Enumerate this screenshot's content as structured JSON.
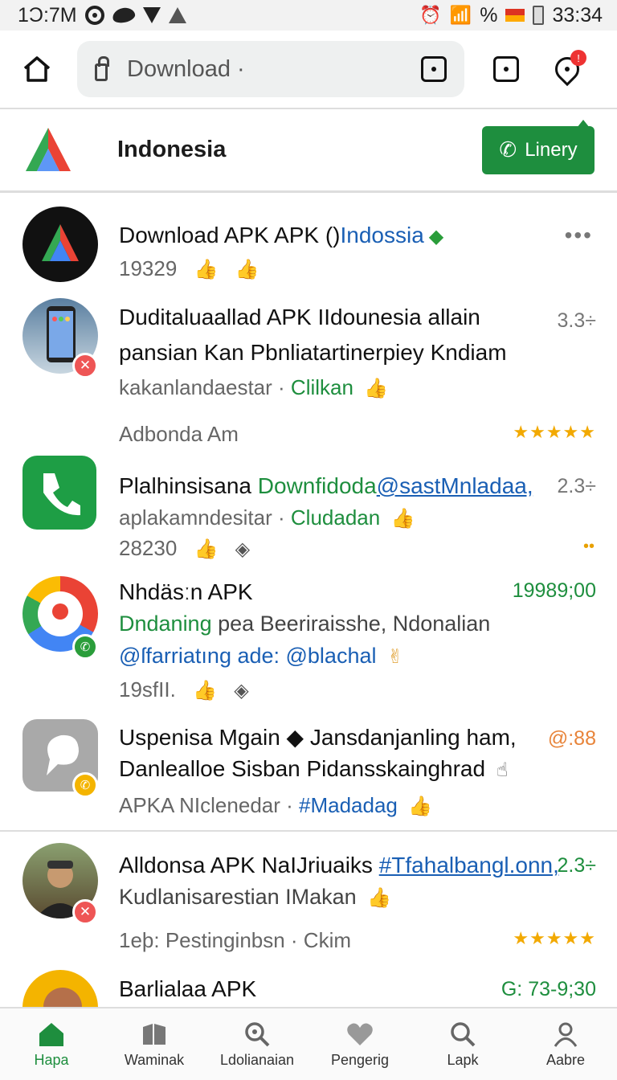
{
  "status_bar": {
    "time_left": "1Ɔ:7M",
    "battery_text": "%",
    "time_right": "33:34"
  },
  "toolbar": {
    "url_text": "Download ·"
  },
  "header": {
    "title": "Indonesia",
    "call_button_label": "Linery"
  },
  "items": [
    {
      "title": "Download APK APK ()",
      "title_link": "Indossia",
      "stat": "19329"
    },
    {
      "title_line1": "Duditaluaallad APK IIdounesia allain",
      "title_line2": "pansian Kan  Pbnliatartinerpiey Kndiam",
      "sub_grey": "kakanlandaestar ·",
      "sub_green": "Clilkan",
      "meta": "Adbonda Am",
      "rating": "3.3÷",
      "stars": "★★★★★"
    },
    {
      "title_prefix": "Plalhinsisana",
      "title_green": "Downfidoda",
      "title_link": "@sastMnladaa,",
      "sub_grey": "aplakamndesitar ·",
      "sub_green": "Cludadan",
      "stat": "28230",
      "rating": "2.3÷"
    },
    {
      "title": "Nhdäsːn APK",
      "line2_green": "Dndaning",
      "line2_grey": "pea Beeriraisshe, Ndonalian",
      "line3_link": "@ſfarriatıng ade: @blachal",
      "stat": "19sfII.",
      "rating": "19989;00"
    },
    {
      "title_line1": "Uspenisa Mgain ◆ Jansdanjanling ham,",
      "title_line2": "Danlealloe Sisban Pidansskainghrad",
      "sub_grey": "APKA NIclenedar ·",
      "sub_link": "#Madadag",
      "rating": "@:88"
    },
    {
      "title": "Alldonsa APK NaIJriuaiks",
      "title_link": "#Tfahalbangl.onn,",
      "sub_grey": "Kudlanisarestian IMakan",
      "meta": "1eþ: Pestinginbsn · Ckim",
      "rating": "2.3÷",
      "stars": "★★★★★"
    },
    {
      "title": "Barlialaa APK",
      "rating": "G: 73-9;30"
    }
  ],
  "bottom_nav": [
    {
      "label": "Hapa",
      "icon": "home-icon",
      "active": true
    },
    {
      "label": "Waminak",
      "icon": "bookmark-icon",
      "active": false
    },
    {
      "label": "Ldolianaian",
      "icon": "search-icon",
      "active": false
    },
    {
      "label": "Pengerig",
      "icon": "heart-icon",
      "active": false
    },
    {
      "label": "Lapk",
      "icon": "search-icon",
      "active": false
    },
    {
      "label": "Aabre",
      "icon": "person-icon",
      "active": false
    }
  ],
  "colors": {
    "accent_green": "#1e8e3e",
    "link_blue": "#1a5fb4",
    "star_gold": "#f2a900"
  }
}
